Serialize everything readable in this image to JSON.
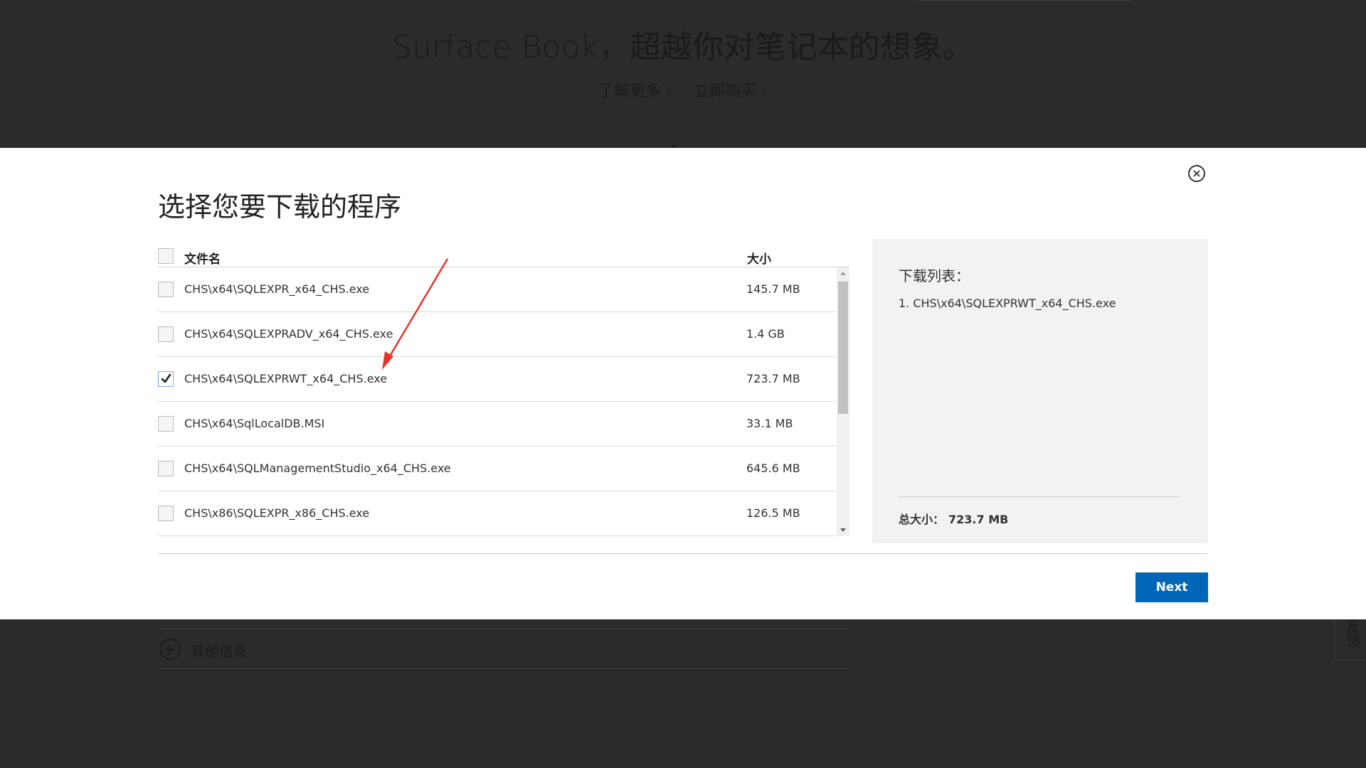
{
  "hero": {
    "title": "Surface Book，超越你对笔记本的想象。",
    "links": [
      "了解更多 ›",
      "立即购买 ›"
    ]
  },
  "dialog": {
    "title": "选择您要下载的程序",
    "columns": {
      "name": "文件名",
      "size": "大小"
    },
    "files": [
      {
        "name": "CHS\\x64\\SQLEXPR_x64_CHS.exe",
        "size": "145.7 MB",
        "checked": false
      },
      {
        "name": "CHS\\x64\\SQLEXPRADV_x64_CHS.exe",
        "size": "1.4 GB",
        "checked": false
      },
      {
        "name": "CHS\\x64\\SQLEXPRWT_x64_CHS.exe",
        "size": "723.7 MB",
        "checked": true
      },
      {
        "name": "CHS\\x64\\SqlLocalDB.MSI",
        "size": "33.1 MB",
        "checked": false
      },
      {
        "name": "CHS\\x64\\SQLManagementStudio_x64_CHS.exe",
        "size": "645.6 MB",
        "checked": false
      },
      {
        "name": "CHS\\x86\\SQLEXPR_x86_CHS.exe",
        "size": "126.5 MB",
        "checked": false
      }
    ],
    "download_list": {
      "title": "下载列表：",
      "items": [
        "1. CHS\\x64\\SQLEXPRWT_x64_CHS.exe"
      ],
      "total_label": "总大小：",
      "total_value": "723.7 MB"
    },
    "next_label": "Next"
  },
  "page_bottom": {
    "other_info_label": "其他信息",
    "feedback_label": "反馈"
  },
  "colors": {
    "dark_bg": "#2b2b2b",
    "accent": "#0067b8",
    "annotation_arrow": "#e8322c",
    "panel_bg": "#f2f2f2"
  },
  "icons": [
    "close-icon",
    "checkmark-icon",
    "plus-circle-icon",
    "scroll-up-icon",
    "scroll-down-icon"
  ]
}
